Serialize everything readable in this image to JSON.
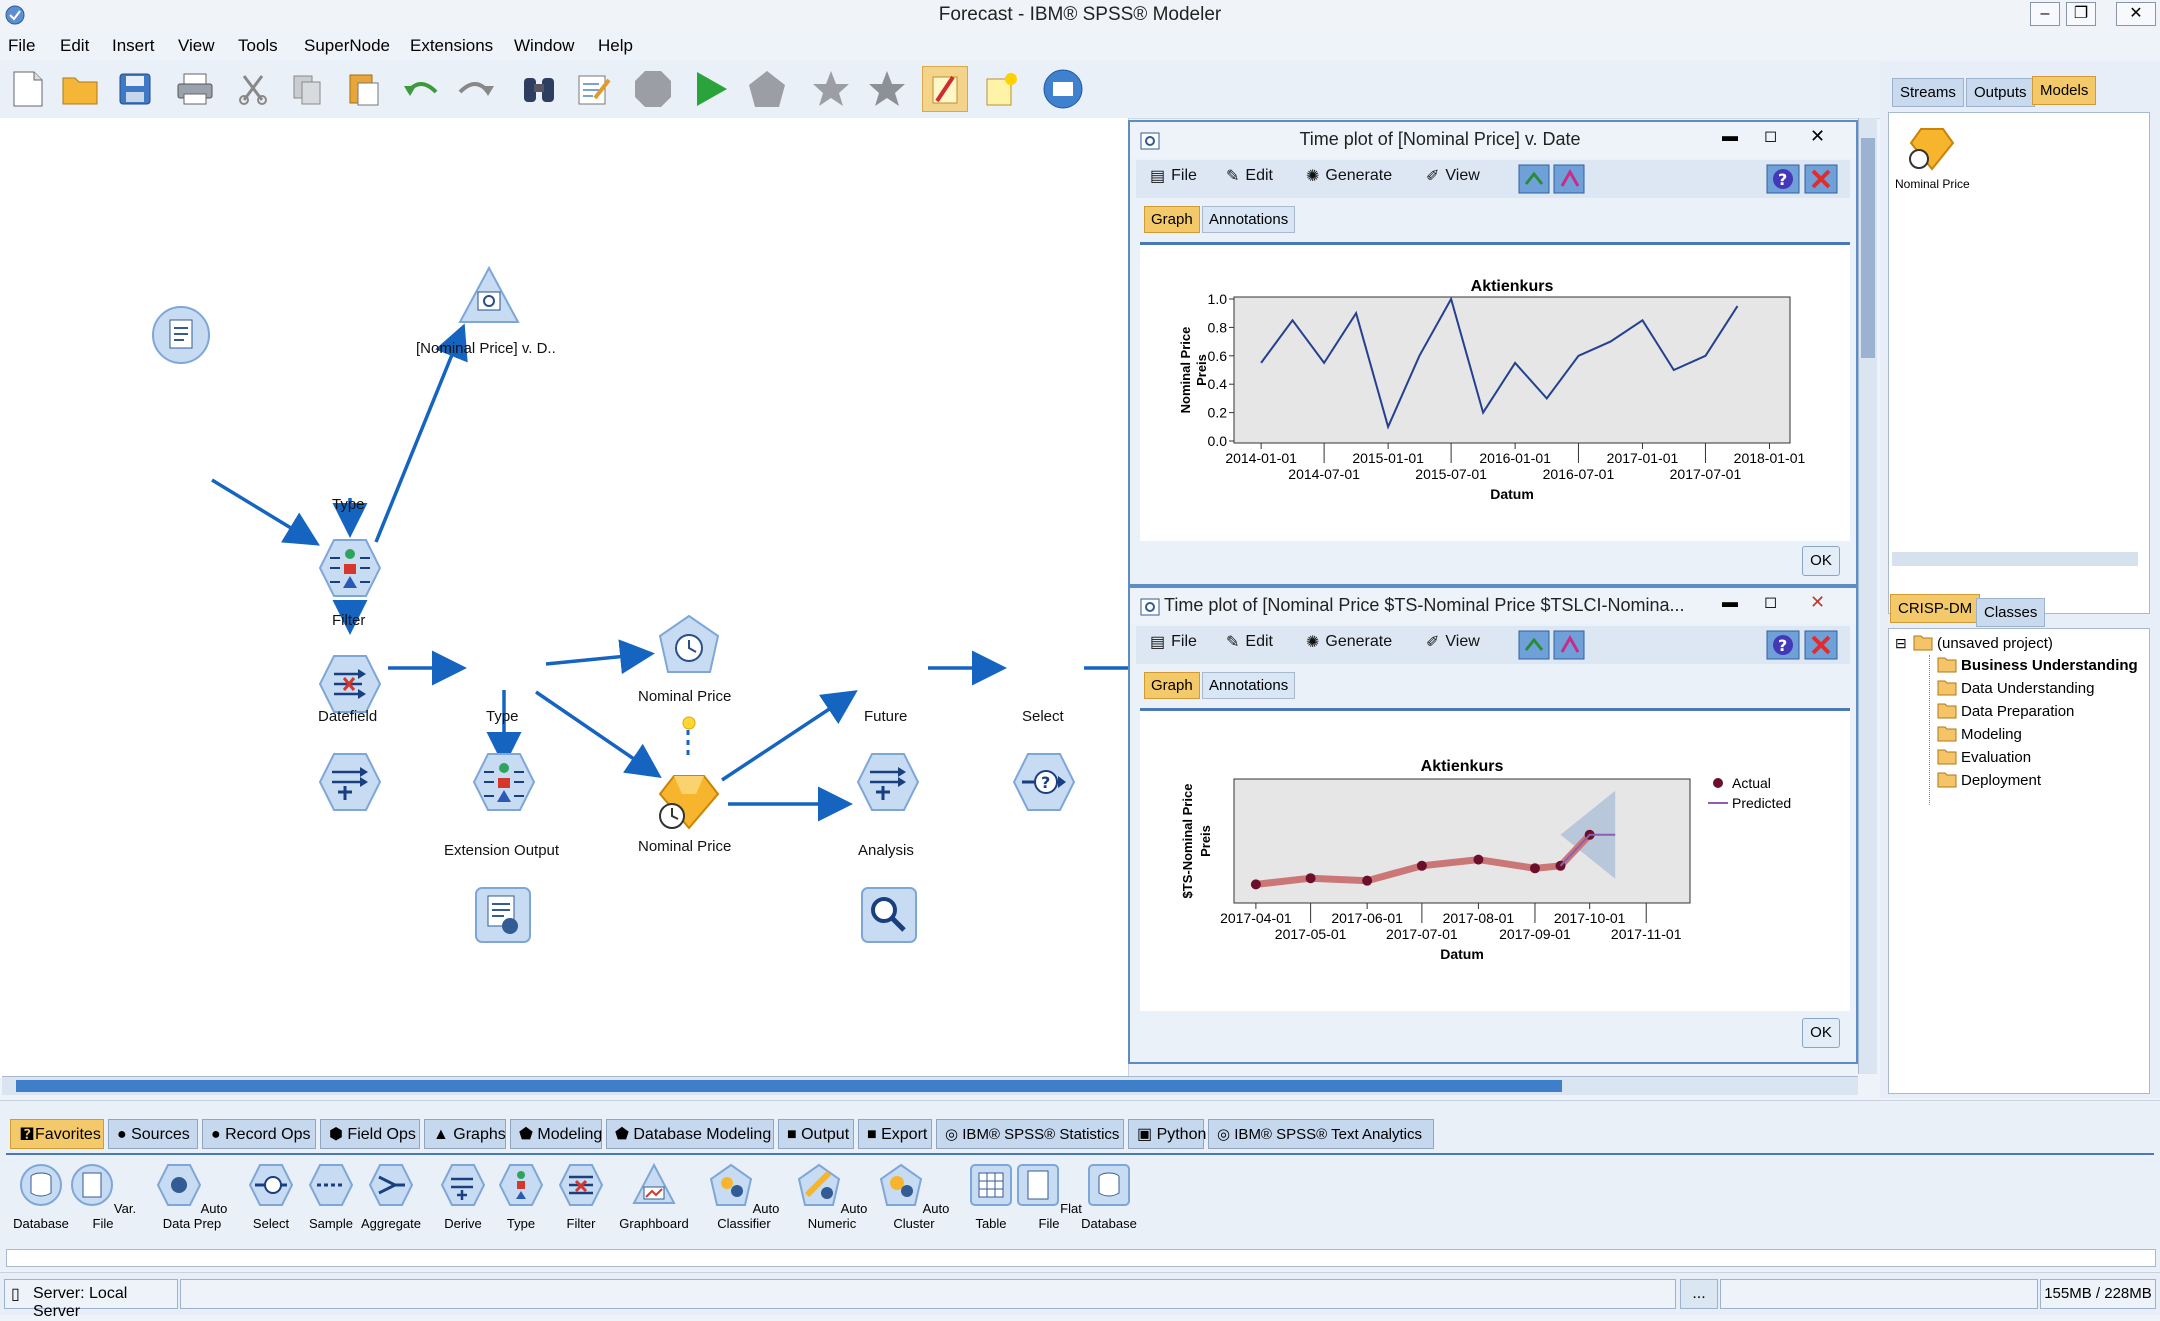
{
  "window": {
    "title": "Forecast - IBM® SPSS® Modeler"
  },
  "menu": [
    "File",
    "Edit",
    "Insert",
    "View",
    "Tools",
    "SuperNode",
    "Extensions",
    "Window",
    "Help"
  ],
  "stream": {
    "nodes": {
      "timeplot": "[Nominal Price] v. D..",
      "type1": "Type",
      "filter": "Filter",
      "datefield": "Datefield",
      "type2": "Type",
      "nominal_output": "Nominal Price",
      "nominal_model": "Nominal Price",
      "extension_output": "Extension Output",
      "future": "Future",
      "select": "Select",
      "analysis": "Analysis"
    }
  },
  "plot1": {
    "title": "Time plot of [Nominal Price] v. Date",
    "menu": {
      "file": "File",
      "edit": "Edit",
      "generate": "Generate",
      "view": "View"
    },
    "tabs": {
      "graph": "Graph",
      "annotations": "Annotations"
    },
    "ok": "OK",
    "chart_title": "Aktienkurs",
    "ylabel1": "Nominal Price",
    "ylabel2": "Preis",
    "xlabel": "Datum",
    "yticks": [
      "1.0",
      "0.8",
      "0.6",
      "0.4",
      "0.2",
      "0.0"
    ],
    "xticks_top": [
      "2014-01-01",
      "2015-01-01",
      "2016-01-01",
      "2017-01-01",
      "2018-01-01"
    ],
    "xticks_bottom": [
      "2014-07-01",
      "2015-07-01",
      "2016-07-01",
      "2017-07-01"
    ]
  },
  "plot2": {
    "title": "Time plot of [Nominal Price $TS-Nominal Price $TSLCI-Nomina...",
    "menu": {
      "file": "File",
      "edit": "Edit",
      "generate": "Generate",
      "view": "View"
    },
    "tabs": {
      "graph": "Graph",
      "annotations": "Annotations"
    },
    "ok": "OK",
    "chart_title": "Aktienkurs",
    "ylabel1": "$TS-Nominal Price",
    "ylabel2": "Preis",
    "xlabel": "Datum",
    "legend": {
      "actual": "Actual",
      "predicted": "Predicted"
    },
    "xticks_top": [
      "2017-04-01",
      "2017-06-01",
      "2017-08-01",
      "2017-10-01"
    ],
    "xticks_bottom": [
      "2017-05-01",
      "2017-07-01",
      "2017-09-01",
      "2017-11-01"
    ]
  },
  "chart_data": [
    {
      "type": "line",
      "title": "Aktienkurs",
      "xlabel": "Datum",
      "ylabel": "Nominal Price / Preis",
      "x": [
        "2014-01-01",
        "2014-04-01",
        "2014-07-01",
        "2014-10-01",
        "2015-01-01",
        "2015-04-01",
        "2015-07-01",
        "2015-10-01",
        "2016-01-01",
        "2016-04-01",
        "2016-07-01",
        "2016-10-01",
        "2017-01-01",
        "2017-04-01",
        "2017-07-01",
        "2017-10-01"
      ],
      "series": [
        {
          "values": [
            0.55,
            0.85,
            0.55,
            0.9,
            0.1,
            0.6,
            1.0,
            0.2,
            0.55,
            0.3,
            0.6,
            0.7,
            0.85,
            0.5,
            0.6,
            0.95
          ]
        }
      ],
      "ylim": [
        0.0,
        1.0
      ]
    },
    {
      "type": "line",
      "title": "Aktienkurs",
      "xlabel": "Datum",
      "ylabel": "$TS-Nominal Price / Preis",
      "x": [
        "2017-04-01",
        "2017-05-01",
        "2017-06-01",
        "2017-07-01",
        "2017-08-01",
        "2017-09-01",
        "2017-09-15",
        "2017-10-01",
        "2017-10-15"
      ],
      "series": [
        {
          "name": "Actual",
          "values": [
            0.15,
            0.2,
            0.18,
            0.3,
            0.35,
            0.28,
            0.3,
            0.55,
            null
          ]
        },
        {
          "name": "Predicted",
          "values": [
            null,
            null,
            null,
            null,
            null,
            null,
            0.3,
            0.55,
            0.55
          ]
        }
      ]
    }
  ],
  "rightpane": {
    "tabs_top": {
      "streams": "Streams",
      "outputs": "Outputs",
      "models": "Models"
    },
    "model_item": "Nominal Price",
    "tabs_bottom": {
      "crisp": "CRISP-DM",
      "classes": "Classes"
    },
    "tree": [
      "(unsaved project)",
      "Business Understanding",
      "Data Understanding",
      "Data Preparation",
      "Modeling",
      "Evaluation",
      "Deployment"
    ]
  },
  "palette": {
    "tabs": [
      "Favorites",
      "Sources",
      "Record Ops",
      "Field Ops",
      "Graphs",
      "Modeling",
      "Database Modeling",
      "Output",
      "Export",
      "IBM® SPSS® Statistics",
      "Python",
      "IBM® SPSS® Text Analytics"
    ],
    "nodes": [
      "Database",
      "Var. File",
      "Auto Data Prep",
      "Select",
      "Sample",
      "Aggregate",
      "Derive",
      "Type",
      "Filter",
      "Graphboard",
      "Auto Classifier",
      "Auto Numeric",
      "Auto Cluster",
      "Table",
      "Flat File",
      "Database"
    ]
  },
  "status": {
    "server": "Server: Local Server",
    "ellipsis": "...",
    "memory": "155MB / 228MB"
  },
  "colors": {
    "accent": "#1565c0",
    "tab_selected": "#f4c969",
    "node_blue": "#7ea7d8"
  }
}
